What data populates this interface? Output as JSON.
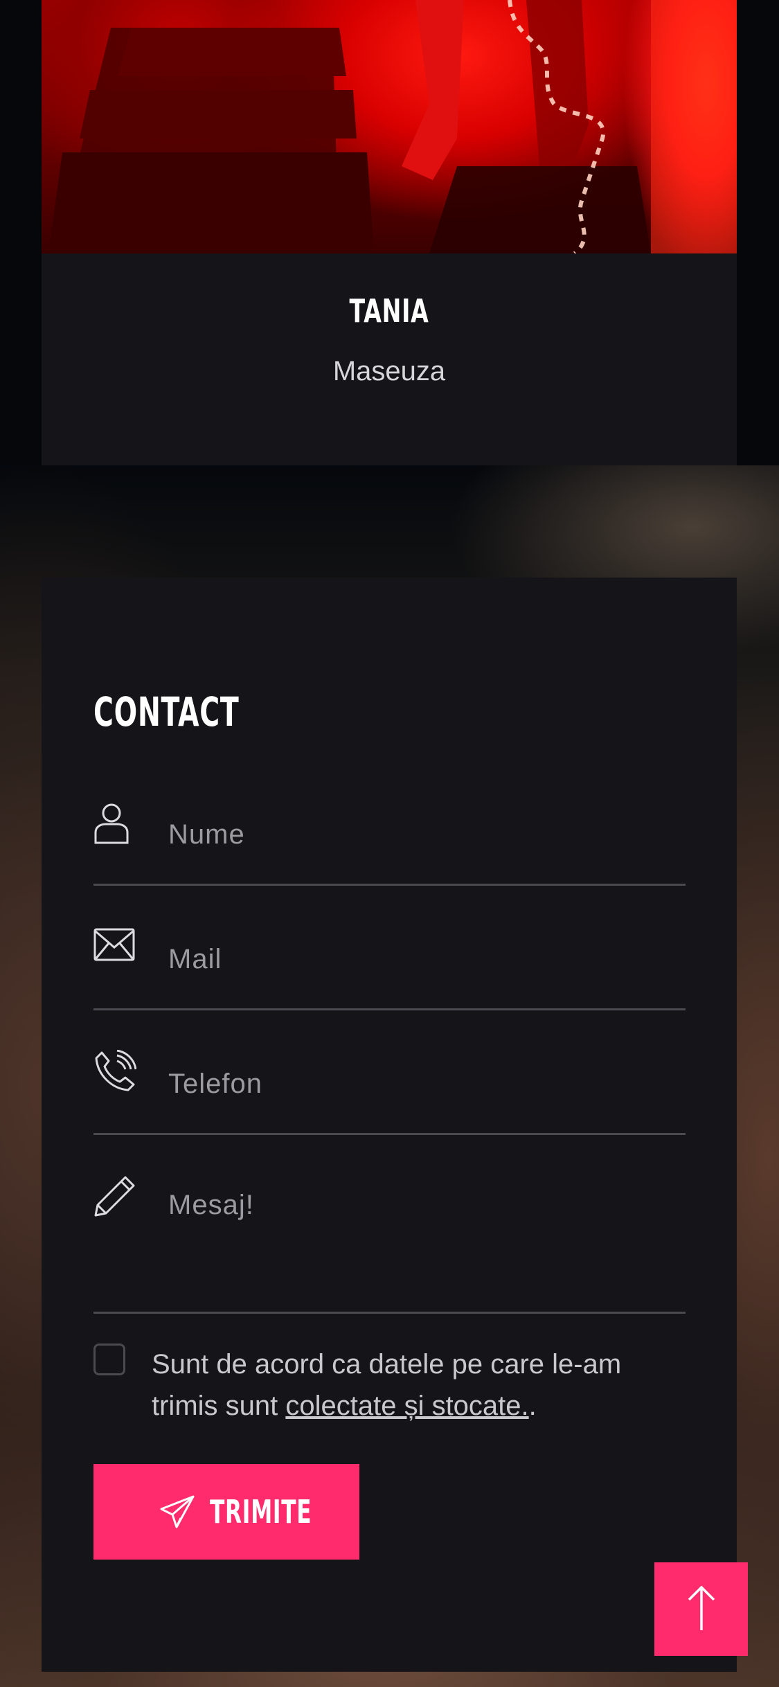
{
  "profile": {
    "name": "TANIA",
    "role": "Maseuza"
  },
  "contact": {
    "title": "CONTACT",
    "fields": {
      "name_placeholder": "Nume",
      "mail_placeholder": "Mail",
      "phone_placeholder": "Telefon",
      "message_placeholder": "Mesaj!"
    },
    "consent": {
      "text_before": "Sunt de acord ca datele pe care le-am trimis sunt ",
      "link_text": "colectate și stocate.",
      "text_after": "."
    },
    "submit_label": "TRIMITE"
  },
  "colors": {
    "accent": "#ff2b6c",
    "card_bg": "#141419",
    "divider": "#4a4a50"
  },
  "icons": [
    "user-icon",
    "envelope-icon",
    "phone-icon",
    "pencil-icon",
    "send-icon",
    "arrow-up-icon"
  ]
}
